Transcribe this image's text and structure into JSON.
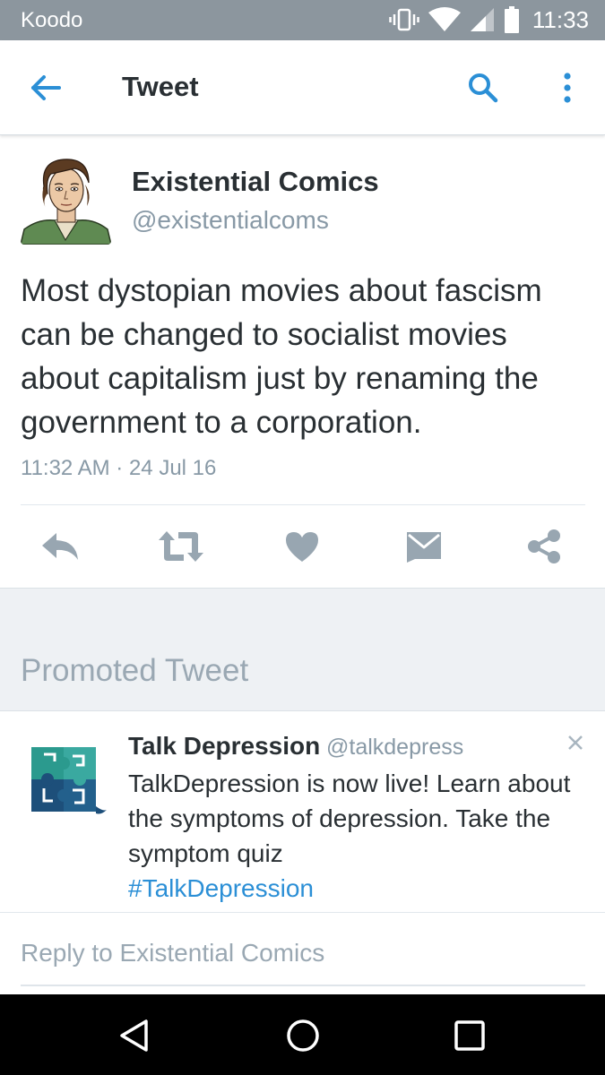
{
  "status_bar": {
    "carrier": "Koodo",
    "time": "11:33"
  },
  "app_bar": {
    "title": "Tweet",
    "icons": [
      "back-arrow-icon",
      "search-icon",
      "more-vertical-icon"
    ]
  },
  "tweet": {
    "display_name": "Existential Comics",
    "handle": "@existentialcoms",
    "text": "Most dystopian movies about fascism can be changed to socialist movies about capitalism just by renaming the government to a corporation.",
    "timestamp": "11:32 AM · 24 Jul 16",
    "actions": [
      "reply-icon",
      "retweet-icon",
      "like-icon",
      "direct-message-icon",
      "share-icon"
    ]
  },
  "promoted": {
    "section_label": "Promoted Tweet",
    "display_name": "Talk Depression",
    "handle": "@talkdepress",
    "text": "TalkDepression is now live! Learn about the symptoms of depression. Take the symptom quiz",
    "hashtag": "#TalkDepression"
  },
  "reply": {
    "placeholder": "Reply to Existential Comics"
  },
  "colors": {
    "accent": "#2b8fd6",
    "status_bar": "#8c969e",
    "action_icon": "#98a6b1",
    "muted_text": "#8899a6"
  }
}
